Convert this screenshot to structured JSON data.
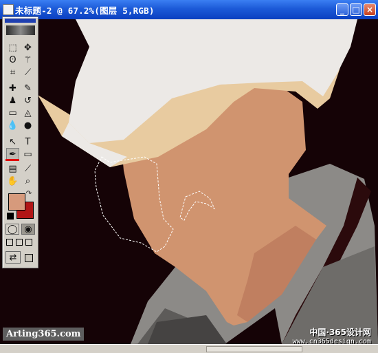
{
  "window": {
    "title": "未标题-2 @ 67.2%(图层 5,RGB)",
    "buttons": {
      "minimize": "_",
      "maximize": "□",
      "close": "×"
    }
  },
  "toolbox": {
    "tools": [
      {
        "id": "marquee",
        "icon": "marquee-icon",
        "glyph": "⬚"
      },
      {
        "id": "move",
        "icon": "move-icon",
        "glyph": "✥"
      },
      {
        "id": "lasso",
        "icon": "lasso-icon",
        "glyph": "ʘ"
      },
      {
        "id": "magic-wand",
        "icon": "magic-wand-icon",
        "glyph": "⚚"
      },
      {
        "id": "crop",
        "icon": "crop-icon",
        "glyph": "⌗"
      },
      {
        "id": "slice",
        "icon": "slice-icon",
        "glyph": "⟋"
      },
      {
        "id": "healing",
        "icon": "healing-brush-icon",
        "glyph": "✚"
      },
      {
        "id": "brush",
        "icon": "brush-icon",
        "glyph": "✎"
      },
      {
        "id": "stamp",
        "icon": "clone-stamp-icon",
        "glyph": "♟"
      },
      {
        "id": "history-brush",
        "icon": "history-brush-icon",
        "glyph": "↺"
      },
      {
        "id": "eraser",
        "icon": "eraser-icon",
        "glyph": "▭"
      },
      {
        "id": "bucket",
        "icon": "paint-bucket-icon",
        "glyph": "◬"
      },
      {
        "id": "blur",
        "icon": "blur-icon",
        "glyph": "💧"
      },
      {
        "id": "dodge",
        "icon": "dodge-icon",
        "glyph": "●"
      },
      {
        "id": "path-select",
        "icon": "path-selection-icon",
        "glyph": "↖"
      },
      {
        "id": "type",
        "icon": "type-icon",
        "glyph": "T"
      },
      {
        "id": "pen",
        "icon": "pen-icon",
        "glyph": "✒"
      },
      {
        "id": "shape",
        "icon": "rectangle-shape-icon",
        "glyph": "▭"
      },
      {
        "id": "notes",
        "icon": "notes-icon",
        "glyph": "▤"
      },
      {
        "id": "eyedropper",
        "icon": "eyedropper-icon",
        "glyph": "⟋"
      },
      {
        "id": "hand",
        "icon": "hand-icon",
        "glyph": "✋"
      },
      {
        "id": "zoom",
        "icon": "zoom-icon",
        "glyph": "⌕"
      }
    ],
    "foreground_color": "#d69a7c",
    "background_color": "#b11616"
  },
  "watermarks": {
    "left": "Arting365.com",
    "right_cn": "中国·365设计网",
    "right_url": "www.cn365design.com"
  },
  "colors": {
    "canvas_background": "#150306",
    "hat_light": "#ece9e6",
    "hat_tan": "#e8cba0",
    "skin": "#d0946f",
    "skin_shadow": "#c07f60",
    "jacket": "#8c8a87",
    "jacket_dark": "#5d5b59"
  }
}
